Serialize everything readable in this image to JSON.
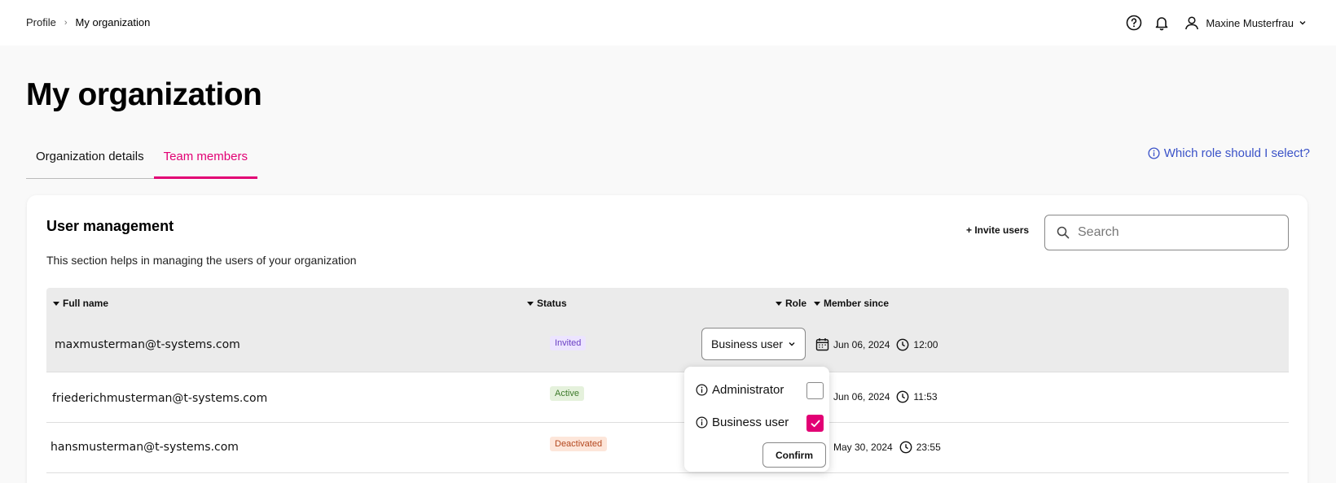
{
  "breadcrumb": {
    "parent": "Profile",
    "separator": "›",
    "current": "My organization"
  },
  "header": {
    "help_icon": "question-circle-icon",
    "notifications_icon": "bell-icon",
    "user_icon": "user-icon",
    "user_name": "Maxine Musterfrau"
  },
  "page": {
    "title": "My organization"
  },
  "tabs": [
    {
      "label": "Organization details",
      "active": false
    },
    {
      "label": "Team members",
      "active": true
    }
  ],
  "help_link": {
    "label": "Which role should I select?"
  },
  "user_management": {
    "title": "User management",
    "description": "This section helps in managing the users of your organization",
    "invite_label": "+ Invite users",
    "search_placeholder": "Search"
  },
  "table": {
    "columns": [
      "Full name",
      "Status",
      "Role",
      "Member since"
    ],
    "rows": [
      {
        "email": "maxmusterman@t-systems.com",
        "status": "Invited",
        "role": "Business user",
        "date": "Jun 06, 2024",
        "time": "12:00"
      },
      {
        "email": "friederichmusterman@t-systems.com",
        "status": "Active",
        "role": "",
        "date": "Jun 06, 2024",
        "time": "11:53"
      },
      {
        "email": "hansmusterman@t-systems.com",
        "status": "Deactivated",
        "role": "",
        "date": "May 30, 2024",
        "time": "23:55"
      }
    ]
  },
  "role_dropdown": {
    "options": [
      {
        "label": "Administrator",
        "checked": false
      },
      {
        "label": "Business user",
        "checked": true
      }
    ],
    "confirm_label": "Confirm"
  },
  "colors": {
    "accent": "#e20074",
    "link": "#3a52c8"
  }
}
